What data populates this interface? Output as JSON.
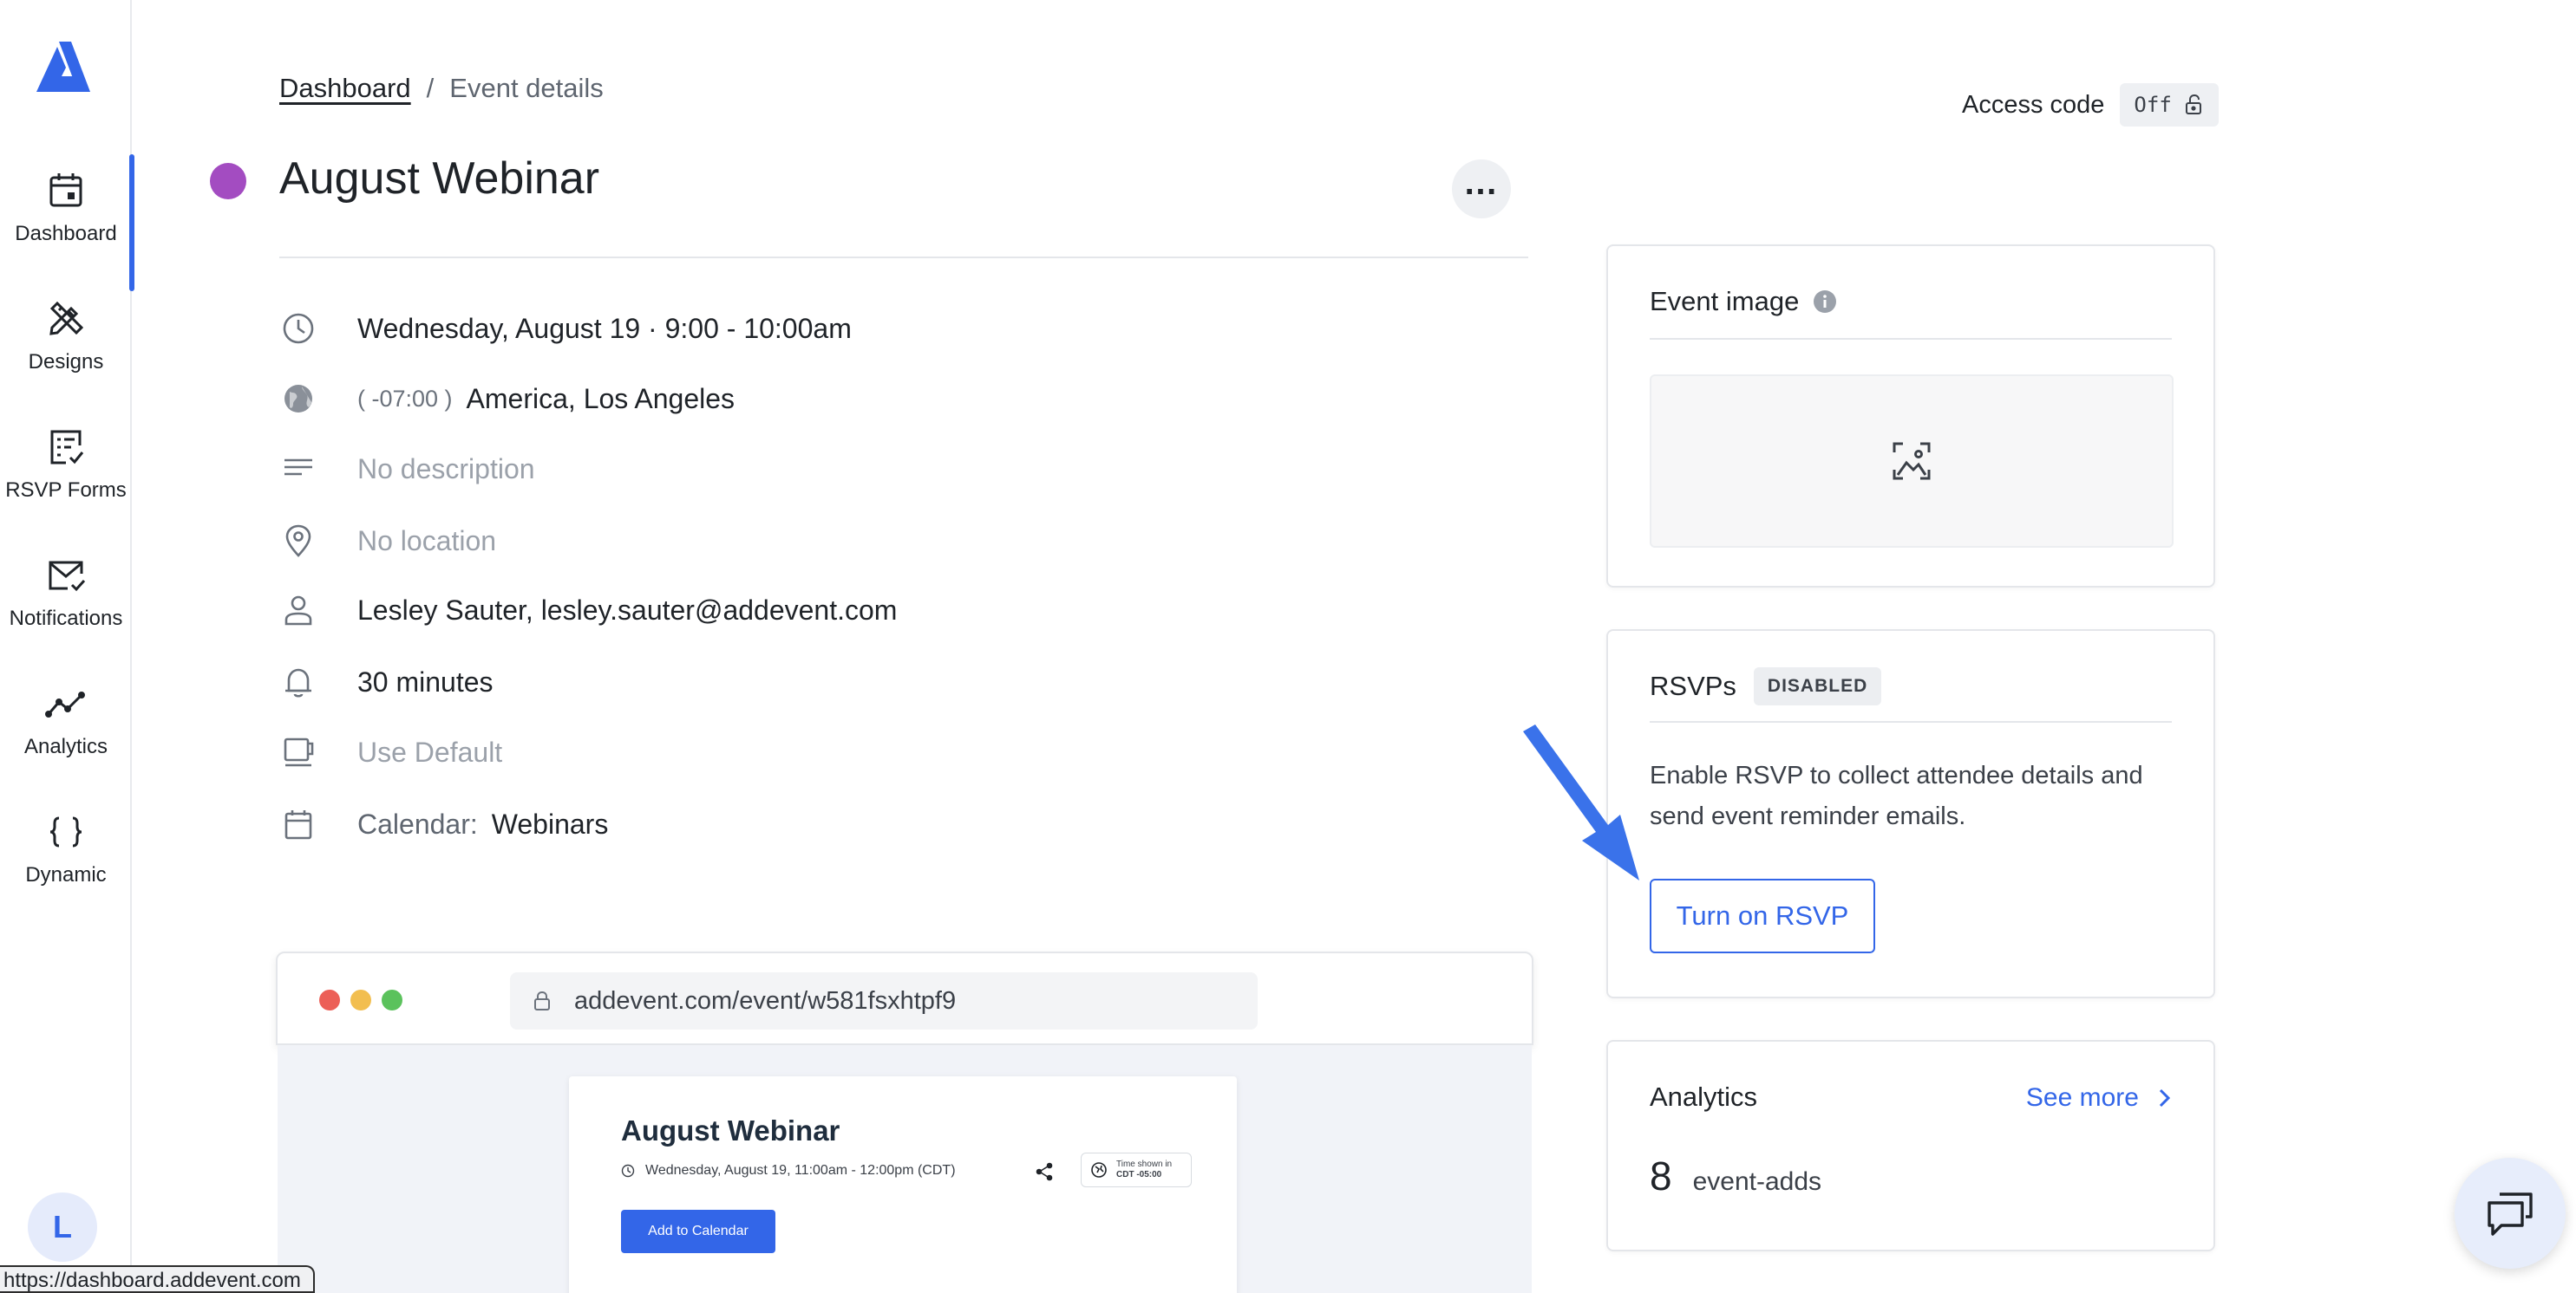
{
  "sidebar": {
    "items": [
      {
        "label": "Dashboard",
        "icon": "calendar-icon"
      },
      {
        "label": "Designs",
        "icon": "pencil-ruler-icon"
      },
      {
        "label": "RSVP Forms",
        "icon": "form-check-icon"
      },
      {
        "label": "Notifications",
        "icon": "mail-check-icon"
      },
      {
        "label": "Analytics",
        "icon": "trend-line-icon"
      },
      {
        "label": "Dynamic",
        "icon": "braces-icon"
      }
    ],
    "active": "Dashboard",
    "avatar_initial": "L"
  },
  "status_url": "https://dashboard.addevent.com",
  "breadcrumb": {
    "link": "Dashboard",
    "separator": "/",
    "current": "Event details"
  },
  "event": {
    "title": "August Webinar",
    "color": "#a34cc1",
    "datetime": "Wednesday, August 19 · 9:00 - 10:00am",
    "tz_offset": "( -07:00 )",
    "timezone": "America, Los Angeles",
    "description": "No description",
    "location": "No location",
    "organizer": "Lesley Sauter, lesley.sauter@addevent.com",
    "reminder": "30 minutes",
    "template": "Use Default",
    "calendar_label": "Calendar:",
    "calendar": "Webinars"
  },
  "preview": {
    "url": "addevent.com/event/w581fsxhtpf9",
    "card_title": "August Webinar",
    "card_date": "Wednesday, August 19, 11:00am - 12:00pm (CDT)",
    "tz_line1": "Time shown in",
    "tz_line2": "CDT -05:00",
    "add_button": "Add to Calendar"
  },
  "access_code": {
    "label": "Access code",
    "state": "Off"
  },
  "event_image": {
    "title": "Event image"
  },
  "rsvps": {
    "title": "RSVPs",
    "badge": "DISABLED",
    "description": "Enable RSVP to collect attendee details and send event reminder emails.",
    "button": "Turn on RSVP"
  },
  "analytics": {
    "title": "Analytics",
    "see_more": "See more",
    "value": "8",
    "metric": "event-adds"
  },
  "colors": {
    "accent": "#3366e8",
    "event_dot": "#a34cc1"
  }
}
